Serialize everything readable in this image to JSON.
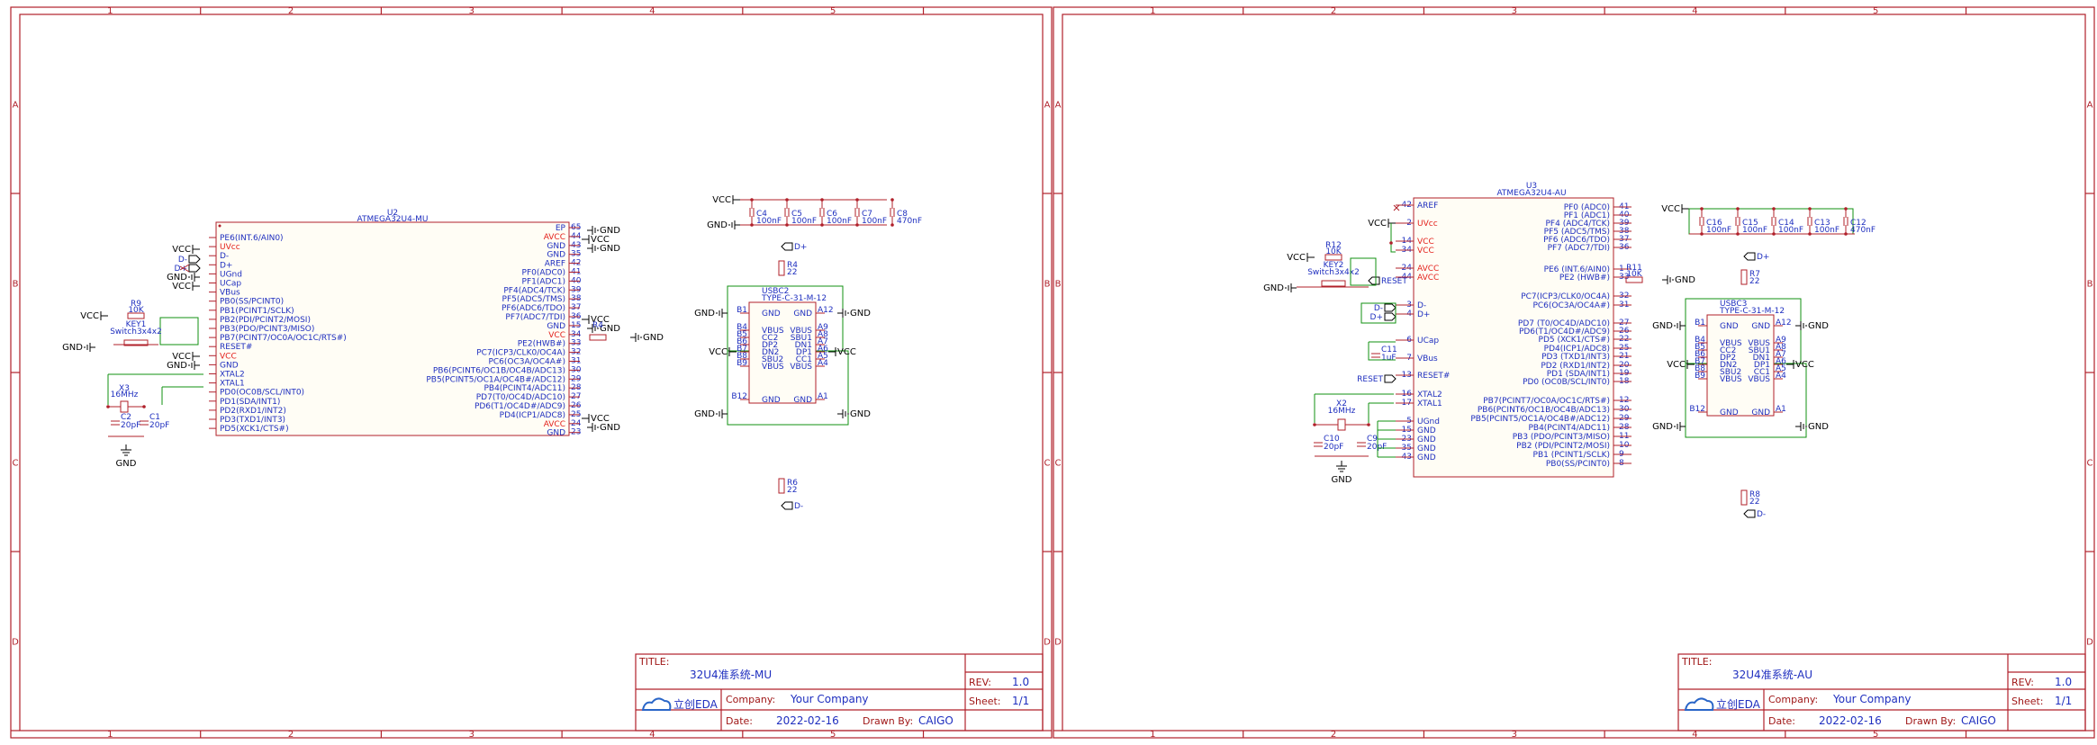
{
  "sheets": [
    {
      "title_label": "TITLE:",
      "title": "32U4准系统-MU",
      "rev_label": "REV:",
      "rev": "1.0",
      "company_label": "Company:",
      "company": "Your Company",
      "sheet_label": "Sheet:",
      "sheet": "1/1",
      "date_label": "Date:",
      "date": "2022-02-16",
      "drawn_label": "Drawn By:",
      "drawn": "CAIGO",
      "logo": "立创EDA",
      "mcu_ref": "U2",
      "mcu_name": "ATMEGA32U4-MU",
      "mcu_left_pins": [
        "PE6(INT.6/AIN0)",
        "UVcc",
        "D-",
        "D+",
        "UGnd",
        "UCap",
        "VBus",
        "PB0(SS/PCINT0)",
        "PB1(PCINT1/SCLK)",
        "PB2(PDI/PCINT2/MOSI)",
        "PB3(PDO/PCINT3/MISO)",
        "PB7(PCINT7/OC0A/OC1C/RTS#)",
        "RESET#",
        "VCC",
        "GND",
        "XTAL2",
        "XTAL1",
        "PD0(OC0B/SCL/INT0)",
        "PD1(SDA/INT1)",
        "PD2(RXD1/INT2)",
        "PD3(TXD1/INT3)",
        "PD5(XCK1/CTS#)"
      ],
      "mcu_right_pins": [
        "EP",
        "AVCC",
        "GND",
        "GND",
        "AREF",
        "PF0(ADC0)",
        "PF1(ADC1)",
        "PF4(ADC4/TCK)",
        "PF5(ADC5/TMS)",
        "PF6(ADC6/TDO)",
        "PF7(ADC7/TDI)",
        "GND",
        "VCC",
        "PE2(HWB#)",
        "PC7(ICP3/CLK0/OC4A)",
        "PC6(OC3A/OC4A#)",
        "PB6(PCINT6/OC1B/OC4B/ADC13)",
        "PB5(PCINT5/OC1A/OC4B#/ADC12)",
        "PB4(PCINT4/ADC11)",
        "PD7(T0/OC4D/ADC10)",
        "PD6(T1/OC4D#/ADC9)",
        "PD4(ICP1/ADC8)",
        "AVCC",
        "GND"
      ],
      "mcu_right_nums": [
        "65",
        "44",
        "43",
        "35",
        "42",
        "41",
        "40",
        "39",
        "38",
        "37",
        "36",
        "15",
        "34",
        "33",
        "32",
        "31",
        "30",
        "29",
        "28",
        "27",
        "26",
        "25",
        "24",
        "23"
      ]
    },
    {
      "title_label": "TITLE:",
      "title": "32U4准系统-AU",
      "rev_label": "REV:",
      "rev": "1.0",
      "company_label": "Company:",
      "company": "Your Company",
      "sheet_label": "Sheet:",
      "sheet": "1/1",
      "date_label": "Date:",
      "date": "2022-02-16",
      "drawn_label": "Drawn By:",
      "drawn": "CAIGO",
      "logo": "立创EDA",
      "mcu_ref": "U3",
      "mcu_name": "ATMEGA32U4-AU",
      "mcu_left_pins": [
        "AREF",
        "UVcc",
        "VCC",
        "VCC",
        "AVCC",
        "AVCC",
        "D-",
        "D+",
        "UCap",
        "VBus",
        "RESET#",
        "XTAL2",
        "XTAL1",
        "UGnd",
        "GND",
        "GND",
        "GND",
        "GND"
      ],
      "mcu_left_nums": [
        "42",
        "2",
        "14",
        "34",
        "24",
        "44",
        "3",
        "4",
        "6",
        "7",
        "13",
        "16",
        "17",
        "5",
        "15",
        "23",
        "35",
        "43"
      ],
      "mcu_right_pins": [
        "PF0 (ADC0)",
        "PF1 (ADC1)",
        "PF4 (ADC4/TCK)",
        "PF5 (ADC5/TMS)",
        "PF6 (ADC6/TDO)",
        "PF7 (ADC7/TDI)",
        "PE6 (INT.6/AIN0)",
        "PE2 (HWB#)",
        "PC7(ICP3/CLK0/OC4A)",
        "PC6(OC3A/OC4A#)",
        "PD7 (T0/OC4D/ADC10)",
        "PD6(T1/OC4D#/ADC9)",
        "PD5 (XCK1/CTS#)",
        "PD4(ICP1/ADC8)",
        "PD3 (TXD1/INT3)",
        "PD2 (RXD1/INT2)",
        "PD1 (SDA/INT1)",
        "PD0 (OC0B/SCL/INT0)",
        "PB7(PCINT7/OC0A/OC1C/RTS#)",
        "PB6(PCINT6/OC1B/OC4B/ADC13)",
        "PB5(PCINT5/OC1A/OC4B#/ADC12)",
        "PB4(PCINT4/ADC11)",
        "PB3 (PDO/PCINT3/MISO)",
        "PB2 (PDI/PCINT2/MOSI)",
        "PB1 (PCINT1/SCLK)",
        "PB0(SS/PCINT0)"
      ],
      "mcu_right_nums": [
        "41",
        "40",
        "39",
        "38",
        "37",
        "36",
        "1",
        "33",
        "32",
        "31",
        "27",
        "26",
        "22",
        "25",
        "21",
        "20",
        "19",
        "18",
        "12",
        "30",
        "29",
        "28",
        "11",
        "10",
        "9",
        "8"
      ]
    }
  ],
  "grid_cols": [
    "1",
    "2",
    "3",
    "4",
    "5"
  ],
  "grid_rows": [
    "A",
    "B",
    "C",
    "D"
  ],
  "nets": {
    "vcc": "VCC",
    "gnd": "GND",
    "dplus": "D+",
    "dminus": "D-",
    "reset": "RESET"
  },
  "parts1": {
    "r9": {
      "ref": "R9",
      "val": "10K"
    },
    "key1": {
      "ref": "KEY1",
      "val": "Switch3x4x2"
    },
    "x3": {
      "ref": "X3",
      "val": "16MHz"
    },
    "c2": {
      "ref": "C2",
      "val": "20pF"
    },
    "c1": {
      "ref": "C1",
      "val": "20pF"
    },
    "c4": {
      "ref": "C4",
      "val": "100nF"
    },
    "c5": {
      "ref": "C5",
      "val": "100nF"
    },
    "c6": {
      "ref": "C6",
      "val": "100nF"
    },
    "c7": {
      "ref": "C7",
      "val": "100nF"
    },
    "c8": {
      "ref": "C8",
      "val": "470nF"
    },
    "r4": {
      "ref": "R4",
      "val": "22"
    },
    "r6": {
      "ref": "R6",
      "val": "22"
    },
    "usb": {
      "ref": "USBC2",
      "val": "TYPE-C-31-M-12"
    }
  },
  "parts2": {
    "r12": {
      "ref": "R12",
      "val": "10K"
    },
    "key2": {
      "ref": "KEY2",
      "val": "Switch3x4x2"
    },
    "x2": {
      "ref": "X2",
      "val": "16MHz"
    },
    "c10": {
      "ref": "C10",
      "val": "20pF"
    },
    "c9": {
      "ref": "C9",
      "val": "20pF"
    },
    "c11": {
      "ref": "C11",
      "val": "1uF"
    },
    "c16": {
      "ref": "C16",
      "val": "100nF"
    },
    "c15": {
      "ref": "C15",
      "val": "100nF"
    },
    "c14": {
      "ref": "C14",
      "val": "100nF"
    },
    "c13": {
      "ref": "C13",
      "val": "100nF"
    },
    "c12": {
      "ref": "C12",
      "val": "470nF"
    },
    "r11": {
      "ref": "R11",
      "val": "10K"
    },
    "r7": {
      "ref": "R7",
      "val": "22"
    },
    "r8": {
      "ref": "R8",
      "val": "22"
    },
    "usb": {
      "ref": "USBC3",
      "val": "TYPE-C-31-M-12"
    }
  },
  "usb_pins_left": [
    "GND",
    "VBUS",
    "CC2",
    "DP2",
    "DN2",
    "SBU2",
    "VBUS",
    "GND"
  ],
  "usb_pins_right": [
    "GND",
    "VBUS",
    "SBU1",
    "DN1",
    "DP1",
    "CC1",
    "VBUS",
    "GND"
  ],
  "usb_nums_left": [
    "B1",
    "B4",
    "B5",
    "B6",
    "B7",
    "B8",
    "B9",
    "B12"
  ],
  "usb_nums_right": [
    "A12",
    "A9",
    "A8",
    "A7",
    "A6",
    "A5",
    "A4",
    "A1"
  ]
}
